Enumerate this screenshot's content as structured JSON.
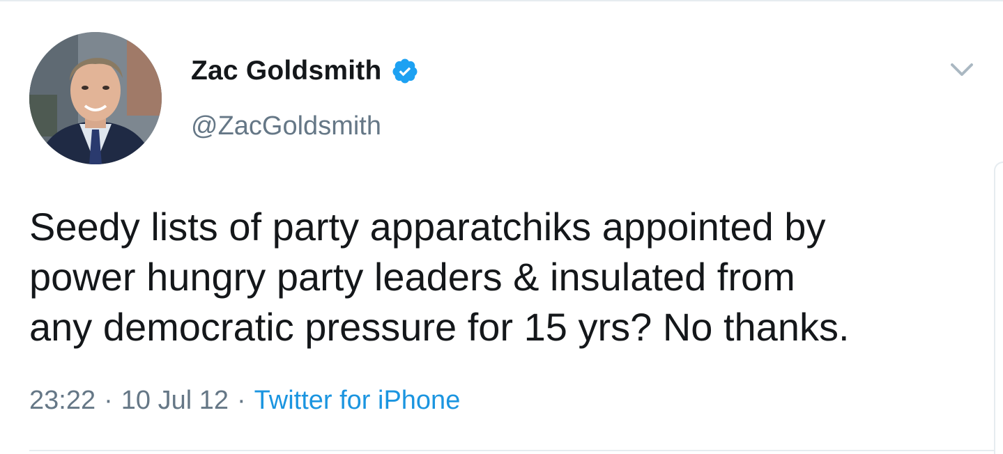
{
  "tweet": {
    "author": {
      "display_name": "Zac Goldsmith",
      "handle": "@ZacGoldsmith",
      "verified": true
    },
    "text": "Seedy lists of party apparatchiks appointed by\npower hungry party leaders & insulated from\nany democratic pressure for 15 yrs? No thanks.",
    "time": "23:22",
    "separator": "·",
    "date": "10 Jul 12",
    "source": "Twitter for iPhone"
  },
  "icons": {
    "verified": "verified-badge-icon",
    "menu": "chevron-down-icon"
  },
  "colors": {
    "verified_blue": "#1da1f2",
    "link_blue": "#1b95e0",
    "secondary_text": "#657786",
    "primary_text": "#14171a"
  }
}
